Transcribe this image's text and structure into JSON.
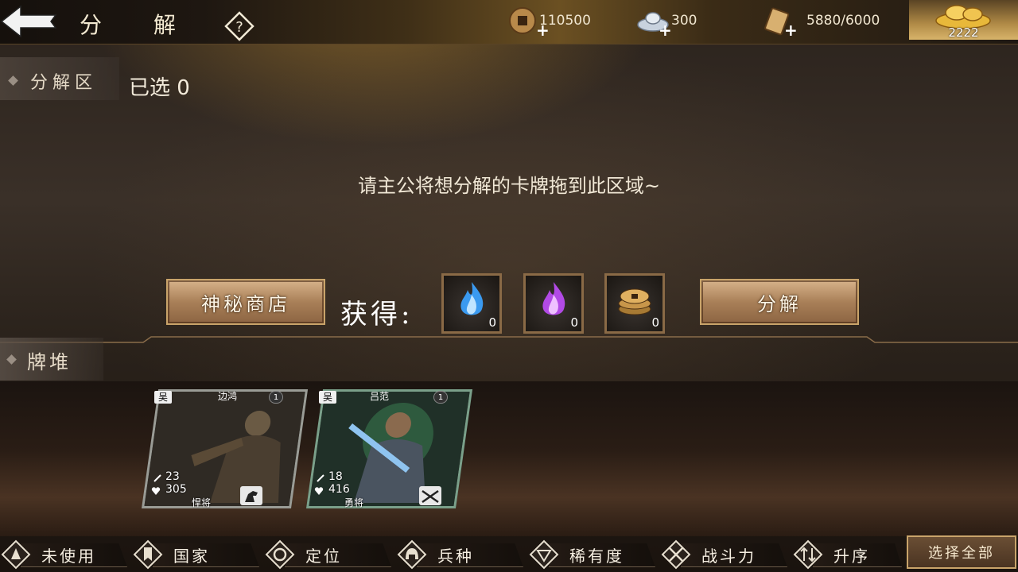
{
  "header": {
    "title": "分 解",
    "resources": [
      {
        "icon": "copper-coin-icon",
        "value": "110500"
      },
      {
        "icon": "silver-ingot-icon",
        "value": "300"
      },
      {
        "icon": "token-scroll-icon",
        "value": "5880/6000"
      }
    ],
    "gold": {
      "icon": "gold-ingot-icon",
      "value": "2222"
    }
  },
  "zone": {
    "label": "分解区",
    "selected": "已选 0",
    "hint": "请主公将想分解的卡牌拖到此区域~"
  },
  "actions": {
    "shop_label": "神秘商店",
    "gain_label": "获得:",
    "rewards": [
      {
        "icon": "blue-flame-icon",
        "count": "0"
      },
      {
        "icon": "purple-flame-icon",
        "count": "0"
      },
      {
        "icon": "coin-stack-icon",
        "count": "0"
      }
    ],
    "decompose_label": "分解"
  },
  "pile": {
    "label": "牌堆",
    "cards": [
      {
        "faction": "吴",
        "name": "边鸿",
        "level": "1",
        "attack": "23",
        "health": "305",
        "class": "悍将",
        "type_icon": "cavalry-horse-icon"
      },
      {
        "faction": "吴",
        "name": "吕范",
        "level": "1",
        "attack": "18",
        "health": "416",
        "class": "勇将",
        "type_icon": "crossbow-icon"
      }
    ]
  },
  "toolbar": {
    "filters": [
      {
        "label": "未使用",
        "icon": "unused-icon"
      },
      {
        "label": "国家",
        "icon": "banner-icon"
      },
      {
        "label": "定位",
        "icon": "target-icon"
      },
      {
        "label": "兵种",
        "icon": "helmet-icon"
      },
      {
        "label": "稀有度",
        "icon": "gem-icon"
      },
      {
        "label": "战斗力",
        "icon": "crossed-swords-icon"
      },
      {
        "label": "升序",
        "icon": "sort-arrows-icon"
      }
    ],
    "select_all": "选择全部"
  }
}
